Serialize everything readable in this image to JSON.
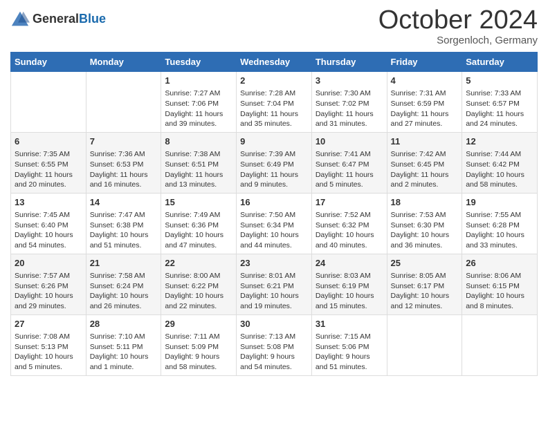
{
  "header": {
    "logo_general": "General",
    "logo_blue": "Blue",
    "month_title": "October 2024",
    "location": "Sorgenloch, Germany"
  },
  "days_of_week": [
    "Sunday",
    "Monday",
    "Tuesday",
    "Wednesday",
    "Thursday",
    "Friday",
    "Saturday"
  ],
  "weeks": [
    [
      {
        "day": "",
        "detail": ""
      },
      {
        "day": "",
        "detail": ""
      },
      {
        "day": "1",
        "detail": "Sunrise: 7:27 AM\nSunset: 7:06 PM\nDaylight: 11 hours and 39 minutes."
      },
      {
        "day": "2",
        "detail": "Sunrise: 7:28 AM\nSunset: 7:04 PM\nDaylight: 11 hours and 35 minutes."
      },
      {
        "day": "3",
        "detail": "Sunrise: 7:30 AM\nSunset: 7:02 PM\nDaylight: 11 hours and 31 minutes."
      },
      {
        "day": "4",
        "detail": "Sunrise: 7:31 AM\nSunset: 6:59 PM\nDaylight: 11 hours and 27 minutes."
      },
      {
        "day": "5",
        "detail": "Sunrise: 7:33 AM\nSunset: 6:57 PM\nDaylight: 11 hours and 24 minutes."
      }
    ],
    [
      {
        "day": "6",
        "detail": "Sunrise: 7:35 AM\nSunset: 6:55 PM\nDaylight: 11 hours and 20 minutes."
      },
      {
        "day": "7",
        "detail": "Sunrise: 7:36 AM\nSunset: 6:53 PM\nDaylight: 11 hours and 16 minutes."
      },
      {
        "day": "8",
        "detail": "Sunrise: 7:38 AM\nSunset: 6:51 PM\nDaylight: 11 hours and 13 minutes."
      },
      {
        "day": "9",
        "detail": "Sunrise: 7:39 AM\nSunset: 6:49 PM\nDaylight: 11 hours and 9 minutes."
      },
      {
        "day": "10",
        "detail": "Sunrise: 7:41 AM\nSunset: 6:47 PM\nDaylight: 11 hours and 5 minutes."
      },
      {
        "day": "11",
        "detail": "Sunrise: 7:42 AM\nSunset: 6:45 PM\nDaylight: 11 hours and 2 minutes."
      },
      {
        "day": "12",
        "detail": "Sunrise: 7:44 AM\nSunset: 6:42 PM\nDaylight: 10 hours and 58 minutes."
      }
    ],
    [
      {
        "day": "13",
        "detail": "Sunrise: 7:45 AM\nSunset: 6:40 PM\nDaylight: 10 hours and 54 minutes."
      },
      {
        "day": "14",
        "detail": "Sunrise: 7:47 AM\nSunset: 6:38 PM\nDaylight: 10 hours and 51 minutes."
      },
      {
        "day": "15",
        "detail": "Sunrise: 7:49 AM\nSunset: 6:36 PM\nDaylight: 10 hours and 47 minutes."
      },
      {
        "day": "16",
        "detail": "Sunrise: 7:50 AM\nSunset: 6:34 PM\nDaylight: 10 hours and 44 minutes."
      },
      {
        "day": "17",
        "detail": "Sunrise: 7:52 AM\nSunset: 6:32 PM\nDaylight: 10 hours and 40 minutes."
      },
      {
        "day": "18",
        "detail": "Sunrise: 7:53 AM\nSunset: 6:30 PM\nDaylight: 10 hours and 36 minutes."
      },
      {
        "day": "19",
        "detail": "Sunrise: 7:55 AM\nSunset: 6:28 PM\nDaylight: 10 hours and 33 minutes."
      }
    ],
    [
      {
        "day": "20",
        "detail": "Sunrise: 7:57 AM\nSunset: 6:26 PM\nDaylight: 10 hours and 29 minutes."
      },
      {
        "day": "21",
        "detail": "Sunrise: 7:58 AM\nSunset: 6:24 PM\nDaylight: 10 hours and 26 minutes."
      },
      {
        "day": "22",
        "detail": "Sunrise: 8:00 AM\nSunset: 6:22 PM\nDaylight: 10 hours and 22 minutes."
      },
      {
        "day": "23",
        "detail": "Sunrise: 8:01 AM\nSunset: 6:21 PM\nDaylight: 10 hours and 19 minutes."
      },
      {
        "day": "24",
        "detail": "Sunrise: 8:03 AM\nSunset: 6:19 PM\nDaylight: 10 hours and 15 minutes."
      },
      {
        "day": "25",
        "detail": "Sunrise: 8:05 AM\nSunset: 6:17 PM\nDaylight: 10 hours and 12 minutes."
      },
      {
        "day": "26",
        "detail": "Sunrise: 8:06 AM\nSunset: 6:15 PM\nDaylight: 10 hours and 8 minutes."
      }
    ],
    [
      {
        "day": "27",
        "detail": "Sunrise: 7:08 AM\nSunset: 5:13 PM\nDaylight: 10 hours and 5 minutes."
      },
      {
        "day": "28",
        "detail": "Sunrise: 7:10 AM\nSunset: 5:11 PM\nDaylight: 10 hours and 1 minute."
      },
      {
        "day": "29",
        "detail": "Sunrise: 7:11 AM\nSunset: 5:09 PM\nDaylight: 9 hours and 58 minutes."
      },
      {
        "day": "30",
        "detail": "Sunrise: 7:13 AM\nSunset: 5:08 PM\nDaylight: 9 hours and 54 minutes."
      },
      {
        "day": "31",
        "detail": "Sunrise: 7:15 AM\nSunset: 5:06 PM\nDaylight: 9 hours and 51 minutes."
      },
      {
        "day": "",
        "detail": ""
      },
      {
        "day": "",
        "detail": ""
      }
    ]
  ]
}
